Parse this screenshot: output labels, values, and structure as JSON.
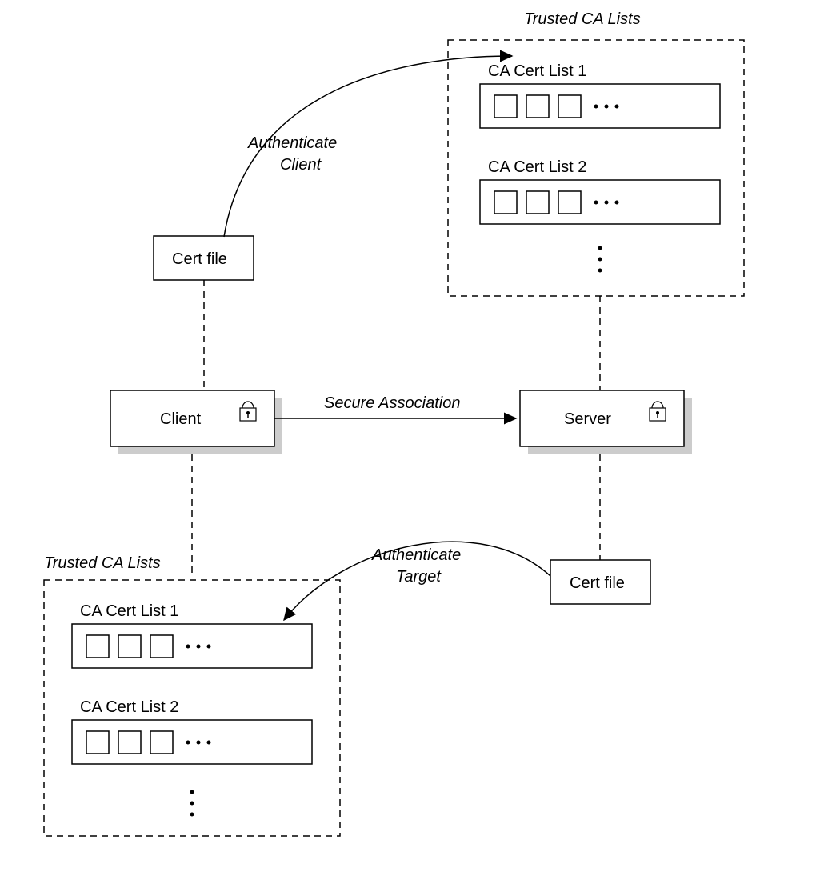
{
  "titles": {
    "trusted_top": "Trusted CA Lists",
    "trusted_bottom": "Trusted CA Lists"
  },
  "labels": {
    "auth_client_l1": "Authenticate",
    "auth_client_l2": "Client",
    "auth_target_l1": "Authenticate",
    "auth_target_l2": "Target",
    "secure_assoc": "Secure Association",
    "client": "Client",
    "server": "Server",
    "cert_file_top": "Cert file",
    "cert_file_bottom": "Cert file",
    "ca_list1_top": "CA Cert List 1",
    "ca_list2_top": "CA Cert List 2",
    "ca_list1_bottom": "CA Cert List 1",
    "ca_list2_bottom": "CA Cert List 2"
  }
}
